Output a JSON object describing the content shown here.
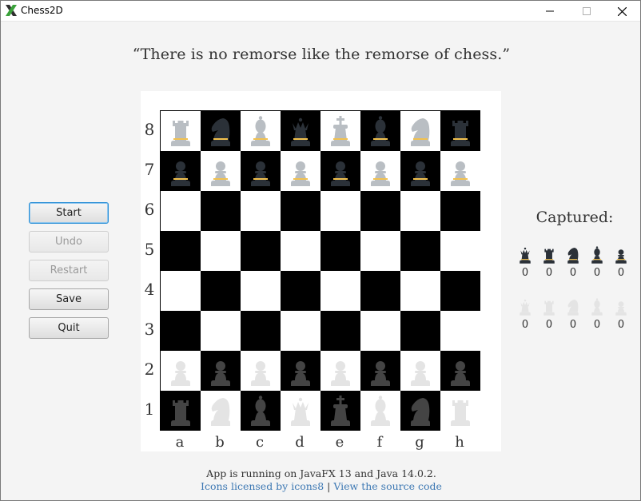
{
  "window": {
    "title": "Chess2D"
  },
  "quote": "“There is no remorse like the remorse of chess.”",
  "controls": [
    {
      "label": "Start",
      "state": "focused"
    },
    {
      "label": "Undo",
      "state": "disabled"
    },
    {
      "label": "Restart",
      "state": "disabled"
    },
    {
      "label": "Save",
      "state": "normal"
    },
    {
      "label": "Quit",
      "state": "normal"
    }
  ],
  "board": {
    "ranks": [
      "8",
      "7",
      "6",
      "5",
      "4",
      "3",
      "2",
      "1"
    ],
    "files": [
      "a",
      "b",
      "c",
      "d",
      "e",
      "f",
      "g",
      "h"
    ],
    "position": [
      [
        "wr",
        "bn",
        "wb",
        "bq",
        "wk",
        "bb",
        "wn",
        "br"
      ],
      [
        "bp",
        "wp",
        "bp",
        "wp",
        "bp",
        "wp",
        "bp",
        "wp"
      ],
      [
        "",
        "",
        "",
        "",
        "",
        "",
        "",
        ""
      ],
      [
        "",
        "",
        "",
        "",
        "",
        "",
        "",
        ""
      ],
      [
        "",
        "",
        "",
        "",
        "",
        "",
        "",
        ""
      ],
      [
        "",
        "",
        "",
        "",
        "",
        "",
        "",
        ""
      ],
      [
        "lp",
        "dp",
        "lp",
        "dp",
        "lp",
        "dp",
        "lp",
        "dp"
      ],
      [
        "dr",
        "ln",
        "db",
        "lq",
        "dk",
        "lb",
        "dn",
        "lr"
      ]
    ]
  },
  "captured": {
    "title": "Captured:",
    "dark_row": [
      {
        "icon": "queen-icon",
        "count": "0"
      },
      {
        "icon": "rook-icon",
        "count": "0"
      },
      {
        "icon": "knight-icon",
        "count": "0"
      },
      {
        "icon": "bishop-icon",
        "count": "0"
      },
      {
        "icon": "pawn-icon",
        "count": "0"
      }
    ],
    "light_row": [
      {
        "icon": "queen-icon",
        "count": "0"
      },
      {
        "icon": "rook-icon",
        "count": "0"
      },
      {
        "icon": "knight-icon",
        "count": "0"
      },
      {
        "icon": "bishop-icon",
        "count": "0"
      },
      {
        "icon": "pawn-icon",
        "count": "0"
      }
    ]
  },
  "footer": {
    "runtime": "App is running on JavaFX 13 and Java 14.0.2.",
    "icons_link": "Icons licensed by icons8",
    "separator": "|",
    "source_link": "View the source code"
  },
  "colors": {
    "light_square": "#ffffff",
    "dark_square": "#000000",
    "focus_border": "#2a8fd6",
    "link": "#3d78b3",
    "piece_white_on_board": "#b9bec3",
    "piece_black_on_board": "#2b3138",
    "piece_light": "#e4e4e4",
    "piece_dark": "#444444",
    "gold_trim": "#f2c14e"
  }
}
